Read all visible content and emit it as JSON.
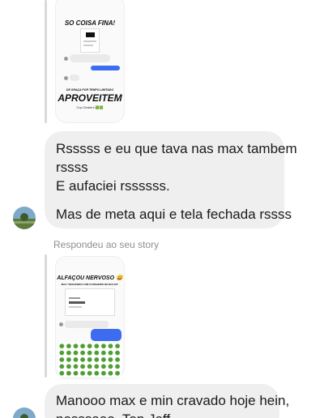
{
  "story1": {
    "headline": "SO COISA FINA!",
    "footer_small": "DE GRAÇA POR TEMPO LIMITADO",
    "footer_big": "APROVEITEM",
    "credit": "Cup Dealers 🟩🟩"
  },
  "messages": [
    {
      "lines": [
        "Rsssss e eu que tava nas max tambem",
        "rssss",
        "E aufaciei rssssss.",
        "",
        "Mas de meta aqui e tela fechada rssss"
      ]
    }
  ],
  "reply_label": "Respondeu ao seu story",
  "story2": {
    "headline": "ALFAÇOU NERVOSO 😄",
    "subline": "MAX \"DESCENDO COM O DINHEIRO NO BOLSO\""
  },
  "message2": {
    "lines": [
      "Manooo max e min cravado hoje hein,",
      "nosssaaa. Top Jeff"
    ]
  },
  "colors": {
    "bubble": "#efefef",
    "sent": "#3d6cf0",
    "green": "#3f8f2e"
  }
}
